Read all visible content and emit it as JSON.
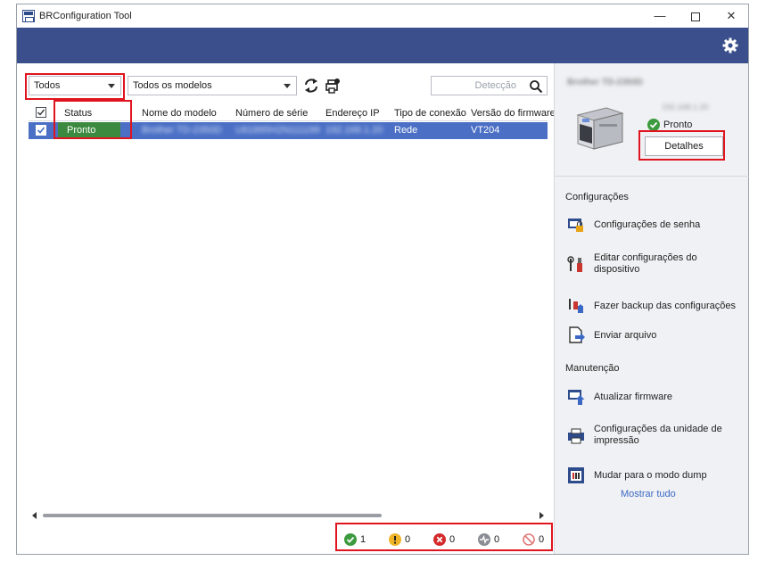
{
  "window": {
    "title": "BRConfiguration Tool",
    "controls": {
      "minimize": "—",
      "close": "✕"
    }
  },
  "colors": {
    "header_bar": "#3a4f8c",
    "row_selected": "#4a6fc5",
    "status_ready": "#3c8a3f",
    "link": "#3b68c4",
    "highlight_box": "#e0141e"
  },
  "toolbar": {
    "filter_status": "Todos",
    "filter_models": "Todos os modelos",
    "search_placeholder": "Detecção",
    "icons": [
      "refresh-icon",
      "add-printer-icon",
      "search-icon"
    ]
  },
  "grid": {
    "columns": [
      "Status",
      "Nome do modelo",
      "Número de série",
      "Endereço IP",
      "Tipo de conexão",
      "Versão do firmware"
    ],
    "rows": [
      {
        "checked": true,
        "status": "Pronto",
        "model": "Brother TD-2350D",
        "serial": "U61895H2N111199",
        "ip": "192.168.1.20",
        "connection": "Rede",
        "firmware": "VT204"
      }
    ]
  },
  "statusbar": {
    "ready_count": "1",
    "warning_count": "0",
    "error_count": "0",
    "offline_count": "0",
    "disabled_count": "0"
  },
  "device_panel": {
    "printer_name": "Brother TD-2350D",
    "ip": "192.168.1.20",
    "status": "Pronto",
    "details_button": "Detalhes"
  },
  "settings": {
    "section_title": "Configurações",
    "items": [
      {
        "label": "Configurações de senha",
        "icon": "password-settings-icon"
      },
      {
        "label": "Editar configurações do dispositivo",
        "icon": "device-settings-icon"
      },
      {
        "label": "Fazer backup das configurações",
        "icon": "backup-icon"
      },
      {
        "label": "Enviar arquivo",
        "icon": "send-file-icon"
      }
    ]
  },
  "maintenance": {
    "section_title": "Manutenção",
    "items": [
      {
        "label": "Atualizar firmware",
        "icon": "firmware-update-icon"
      },
      {
        "label": "Configurações da unidade de impressão",
        "icon": "print-unit-icon"
      },
      {
        "label": "Mudar para o modo dump",
        "icon": "dump-mode-icon"
      }
    ],
    "show_all_link": "Mostrar tudo"
  }
}
